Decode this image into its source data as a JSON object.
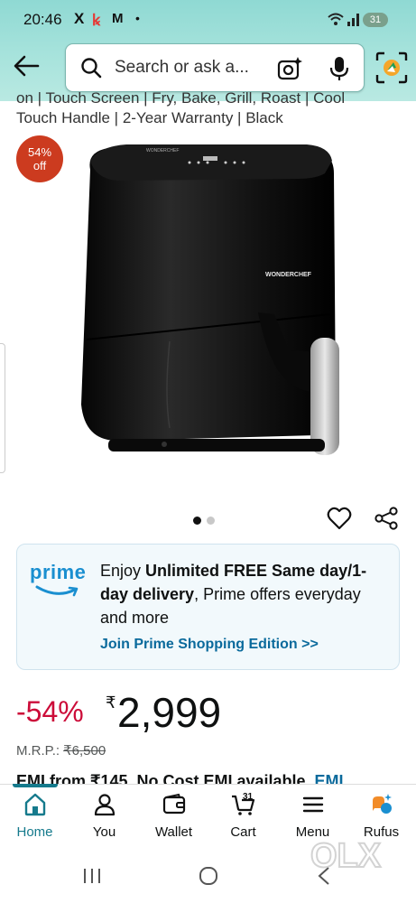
{
  "status_bar": {
    "time": "20:46",
    "notification_icons": [
      "X",
      "ꝃ",
      "M"
    ],
    "dot": "•",
    "battery": "31"
  },
  "search": {
    "placeholder": "Search or ask a..."
  },
  "product": {
    "title_line1": "on | Touch Screen | Fry, Bake, Grill, Roast | Cool",
    "title_line2": "Touch Handle | 2-Year Warranty | Black",
    "badge_pct": "54%",
    "badge_off": "off",
    "brand_on_product": "WONDERCHEF",
    "image_count": 2,
    "active_image": 1
  },
  "prime": {
    "logo": "prime",
    "text_1": "Enjoy ",
    "text_bold": "Unlimited FREE Same day/1-day delivery",
    "text_2": ", Prime offers everyday and more",
    "link": "Join Prime Shopping Edition >>"
  },
  "pricing": {
    "discount": "-54%",
    "currency": "₹",
    "price": "2,999",
    "mrp_label": "M.R.P.:",
    "mrp_value": "₹6,500",
    "emi_text": "EMI from ₹145. No Cost EMI available. ",
    "emi_link": "EMI"
  },
  "bottom_nav": {
    "items": [
      {
        "label": "Home",
        "icon": "home-icon"
      },
      {
        "label": "You",
        "icon": "user-icon"
      },
      {
        "label": "Wallet",
        "icon": "wallet-icon"
      },
      {
        "label": "Cart",
        "icon": "cart-icon",
        "count": "31"
      },
      {
        "label": "Menu",
        "icon": "menu-icon"
      },
      {
        "label": "Rufus",
        "icon": "rufus-icon"
      }
    ],
    "active": "Home"
  },
  "watermark": "OLX",
  "colors": {
    "header_bg": "#a7e3dc",
    "accent": "#157a8c",
    "deal_red": "#cc0c39",
    "badge": "#cc3b1f",
    "prime_blue": "#1a8fd0",
    "link": "#0a6a9c"
  }
}
